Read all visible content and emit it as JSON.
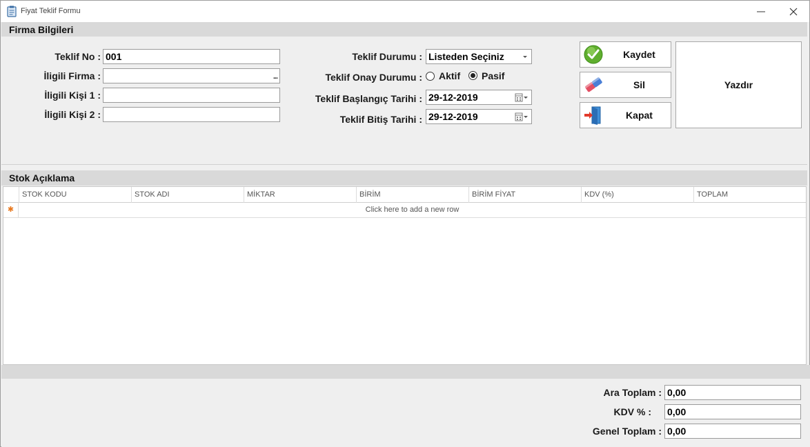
{
  "window": {
    "title": "Fiyat Teklif Formu"
  },
  "sections": {
    "firma": "Firma Bilgileri",
    "stok": "Stok Açıklama"
  },
  "form": {
    "teklif_no": {
      "label": "Teklif No :",
      "value": "001"
    },
    "ilgili_firma": {
      "label": "İligili Firma :",
      "value": "",
      "button": "..."
    },
    "ilgili_kisi1": {
      "label": "İligili Kişi 1 :",
      "value": ""
    },
    "ilgili_kisi2": {
      "label": "İligili Kişi 2 :",
      "value": ""
    },
    "teklif_durumu": {
      "label": "Teklif Durumu :",
      "value": "Listeden Seçiniz"
    },
    "onay_durumu": {
      "label": "Teklif Onay Durumu :",
      "options": [
        "Aktif",
        "Pasif"
      ],
      "selected": "Pasif"
    },
    "baslangic": {
      "label": "Teklif Başlangıç Tarihi :",
      "value": "29-12-2019"
    },
    "bitis": {
      "label": "Teklif Bitiş Tarihi :",
      "value": "29-12-2019"
    }
  },
  "buttons": {
    "kaydet": "Kaydet",
    "sil": "Sil",
    "kapat": "Kapat",
    "yazdir": "Yazdır"
  },
  "grid": {
    "columns": [
      "STOK KODU",
      "STOK ADI",
      "MİKTAR",
      "BİRİM",
      "BİRİM FİYAT",
      "KDV (%)",
      "TOPLAM"
    ],
    "new_row_indicator": "✱",
    "new_row_text": "Click here to add a new row"
  },
  "totals": {
    "ara_toplam": {
      "label": "Ara Toplam :",
      "value": "0,00"
    },
    "kdv": {
      "label": "KDV % :",
      "value": "0,00"
    },
    "genel_toplam": {
      "label": "Genel Toplam :",
      "value": "0,00"
    }
  },
  "icons": {
    "app": "clipboard-icon",
    "minimize": "minimize-icon",
    "close": "close-icon",
    "kaydet": "checkmark-icon",
    "sil": "eraser-icon",
    "kapat": "exit-door-icon",
    "calendar": "calendar-icon"
  }
}
